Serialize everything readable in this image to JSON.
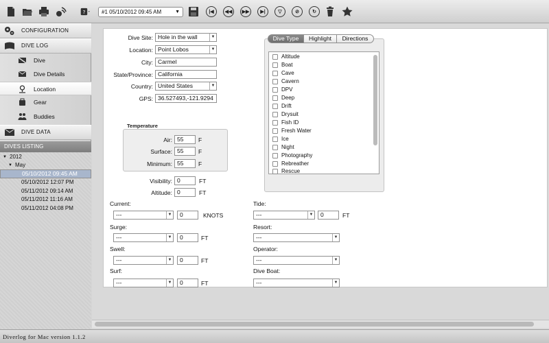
{
  "toolbar": {
    "dive_selector": "#1 05/10/2012 09:45 AM",
    "icons": [
      "new-document-icon",
      "open-folder-icon",
      "print-icon",
      "wireless-sync-icon",
      "help-icon",
      "save-icon",
      "first-dive-icon",
      "previous-dive-icon",
      "next-dive-icon",
      "last-dive-icon",
      "filter-icon",
      "no-filter-icon",
      "refresh-icon",
      "trash-icon",
      "star-icon"
    ]
  },
  "sidebar": {
    "configuration": "CONFIGURATION",
    "dive_log": "DIVE LOG",
    "items": [
      {
        "label": "Dive",
        "icon": "dive-flag-icon"
      },
      {
        "label": "Dive Details",
        "icon": "envelope-icon"
      },
      {
        "label": "Location",
        "icon": "location-pin-icon"
      },
      {
        "label": "Gear",
        "icon": "gear-bag-icon"
      },
      {
        "label": "Buddies",
        "icon": "people-icon"
      }
    ],
    "dive_data": "DIVE DATA",
    "listing_header": "DIVES LISTING",
    "tree": {
      "year": "2012",
      "month": "May",
      "dives": [
        "05/10/2012 09:45 AM",
        "05/10/2012 12:07 PM",
        "05/11/2012 09:14 AM",
        "05/11/2012 11:16 AM",
        "05/11/2012 04:08 PM"
      ]
    }
  },
  "form": {
    "dive_site_label": "Dive Site:",
    "dive_site": "Hole in the wall",
    "location_label": "Location:",
    "location": "Point Lobos",
    "city_label": "City:",
    "city": "Carmel",
    "state_label": "State/Province:",
    "state": "California",
    "country_label": "Country:",
    "country": "United States",
    "gps_label": "GPS:",
    "gps": "36.527493,-121.9294",
    "temperature_title": "Temperature",
    "air_label": "Air:",
    "air": "55",
    "surface_label": "Surface:",
    "surface": "55",
    "minimum_label": "Minimum:",
    "minimum": "55",
    "temp_unit": "F",
    "visibility_label": "Visibility:",
    "visibility": "0",
    "altitude_label": "Altitude:",
    "altitude": "0",
    "length_unit": "FT",
    "current_label": "Current:",
    "current_select": "---",
    "current_value": "0",
    "current_unit": "KNOTS",
    "surge_label": "Surge:",
    "surge_select": "---",
    "surge_value": "0",
    "swell_label": "Swell:",
    "swell_select": "---",
    "swell_value": "0",
    "surf_label": "Surf:",
    "surf_select": "---",
    "surf_value": "0",
    "tide_label": "Tide:",
    "tide_select": "---",
    "tide_value": "0",
    "resort_label": "Resort:",
    "resort_select": "---",
    "operator_label": "Operator:",
    "operator_select": "---",
    "dive_boat_label": "Dive Boat:",
    "dive_boat_select": "---"
  },
  "tabs": {
    "dive_type": "Dive Type",
    "highlight": "Highlight",
    "directions": "Directions"
  },
  "dive_types": [
    "Altitude",
    "Boat",
    "Cave",
    "Cavern",
    "DPV",
    "Deep",
    "Drift",
    "Drysuit",
    "Fish ID",
    "Fresh Water",
    "Ice",
    "Night",
    "Photography",
    "Rebreather",
    "Rescue"
  ],
  "footer": {
    "version": "Diverlog for Mac version 1.1.2"
  }
}
